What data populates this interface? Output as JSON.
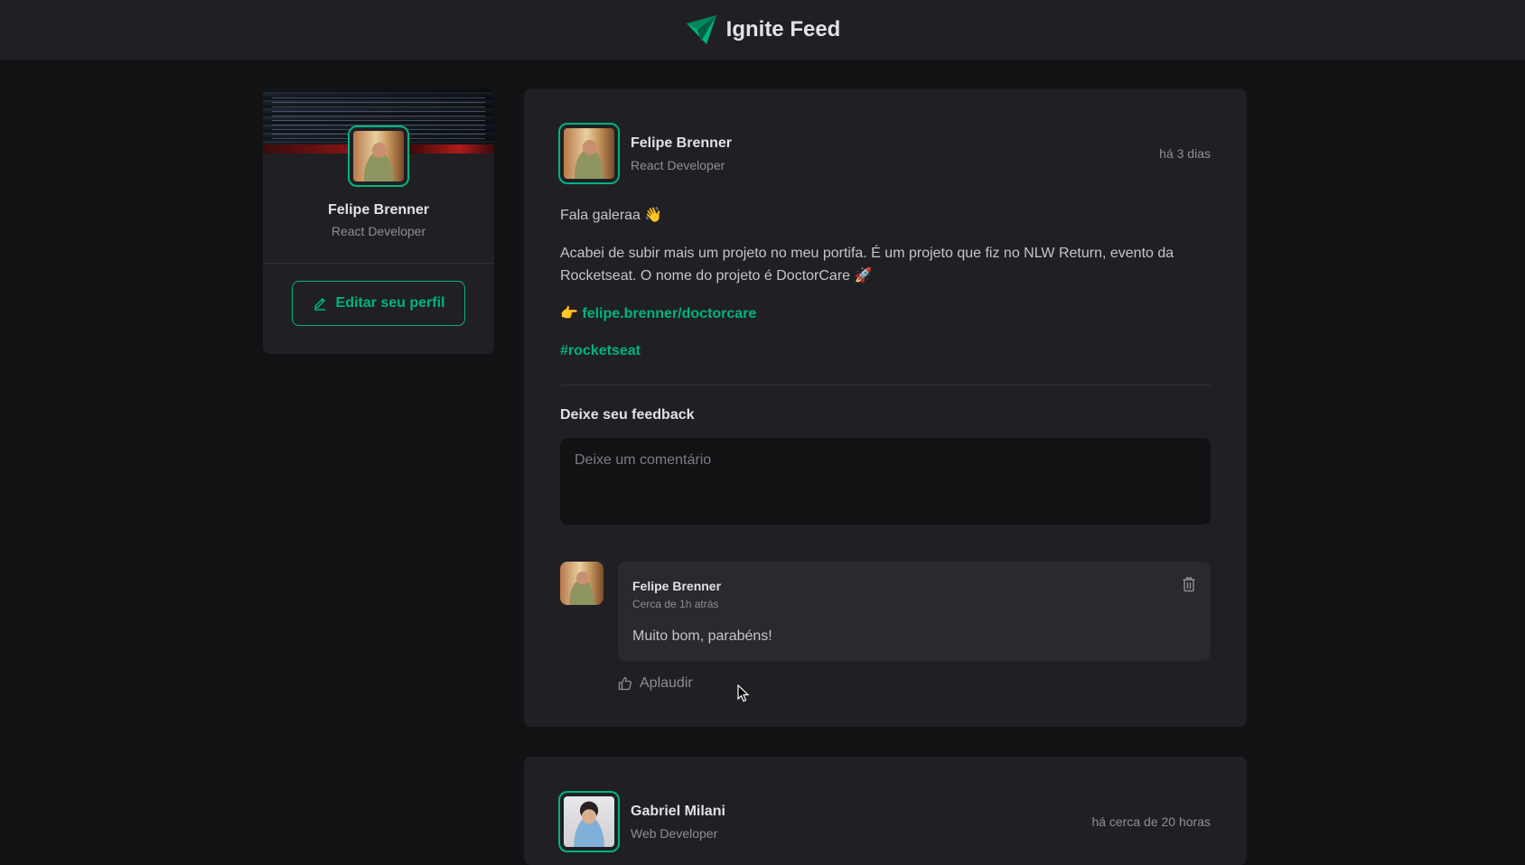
{
  "header": {
    "title": "Ignite Feed"
  },
  "sidebar": {
    "name": "Felipe Brenner",
    "role": "React Developer",
    "edit_label": "Editar seu perfil"
  },
  "posts": [
    {
      "author": {
        "name": "Felipe Brenner",
        "role": "React Developer"
      },
      "time": "há 3 dias",
      "content": {
        "greeting": "Fala galeraa 👋",
        "body": "Acabei de subir mais um projeto no meu portifa. É um projeto que fiz no NLW Return, evento da Rocketseat. O nome do projeto é DoctorCare 🚀",
        "link_prefix": "👉 ",
        "link": "felipe.brenner/doctorcare",
        "hashtag": "#rocketseat"
      },
      "feedback_title": "Deixe seu feedback",
      "comment_placeholder": "Deixe um comentário",
      "comments": [
        {
          "name": "Felipe Brenner",
          "time": "Cerca de 1h atrás",
          "text": "Muito bom, parabéns!",
          "applaud_label": "Aplaudir"
        }
      ]
    },
    {
      "author": {
        "name": "Gabriel Milani",
        "role": "Web Developer"
      },
      "time": "há cerca de 20 horas"
    }
  ],
  "colors": {
    "accent": "#00b37e",
    "background": "#121214",
    "card": "#202024"
  }
}
